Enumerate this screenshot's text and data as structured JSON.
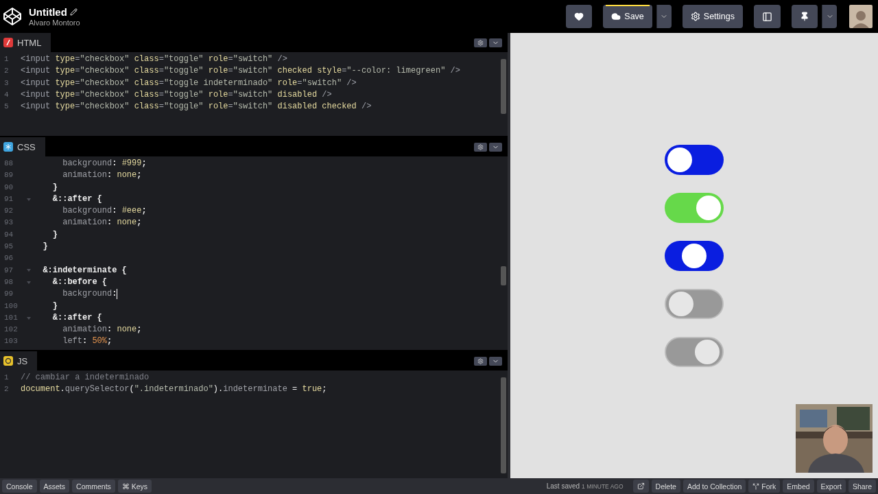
{
  "header": {
    "title": "Untitled",
    "author": "Alvaro Montoro",
    "buttons": [
      {
        "kind": "like"
      },
      {
        "kind": "save",
        "label": "Save",
        "split": true
      },
      {
        "kind": "settings",
        "label": "Settings"
      },
      {
        "kind": "layout"
      },
      {
        "kind": "pin",
        "split": true
      }
    ]
  },
  "editors": [
    {
      "kind": "html",
      "label": "HTML",
      "lines": [
        {
          "number": "1",
          "tokens": [
            {
              "kind": "tag",
              "text": "<input "
            },
            {
              "kind": "attr",
              "text": "type"
            },
            {
              "kind": "tag",
              "text": "="
            },
            {
              "kind": "str",
              "text": "\"checkbox\" "
            },
            {
              "kind": "attr",
              "text": "class"
            },
            {
              "kind": "tag",
              "text": "="
            },
            {
              "kind": "str",
              "text": "\"toggle\" "
            },
            {
              "kind": "attr",
              "text": "role"
            },
            {
              "kind": "tag",
              "text": "="
            },
            {
              "kind": "str",
              "text": "\"switch\" "
            },
            {
              "kind": "tag",
              "text": "/>"
            }
          ]
        },
        {
          "number": "2",
          "tokens": [
            {
              "kind": "tag",
              "text": "<input "
            },
            {
              "kind": "attr",
              "text": "type"
            },
            {
              "kind": "tag",
              "text": "="
            },
            {
              "kind": "str",
              "text": "\"checkbox\" "
            },
            {
              "kind": "attr",
              "text": "class"
            },
            {
              "kind": "tag",
              "text": "="
            },
            {
              "kind": "str",
              "text": "\"toggle\" "
            },
            {
              "kind": "attr",
              "text": "role"
            },
            {
              "kind": "tag",
              "text": "="
            },
            {
              "kind": "str",
              "text": "\"switch\" "
            },
            {
              "kind": "attr",
              "text": "checked style"
            },
            {
              "kind": "tag",
              "text": "="
            },
            {
              "kind": "str",
              "text": "\"--color: limegreen\" "
            },
            {
              "kind": "tag",
              "text": "/>"
            }
          ]
        },
        {
          "number": "3",
          "tokens": [
            {
              "kind": "tag",
              "text": "<input "
            },
            {
              "kind": "attr",
              "text": "type"
            },
            {
              "kind": "tag",
              "text": "="
            },
            {
              "kind": "str",
              "text": "\"checkbox\" "
            },
            {
              "kind": "attr",
              "text": "class"
            },
            {
              "kind": "tag",
              "text": "="
            },
            {
              "kind": "str",
              "text": "\"toggle indeterminado\" "
            },
            {
              "kind": "attr",
              "text": "role"
            },
            {
              "kind": "tag",
              "text": "="
            },
            {
              "kind": "str",
              "text": "\"switch\" "
            },
            {
              "kind": "tag",
              "text": "/>"
            }
          ]
        },
        {
          "number": "4",
          "tokens": [
            {
              "kind": "tag",
              "text": "<input "
            },
            {
              "kind": "attr",
              "text": "type"
            },
            {
              "kind": "tag",
              "text": "="
            },
            {
              "kind": "str",
              "text": "\"checkbox\" "
            },
            {
              "kind": "attr",
              "text": "class"
            },
            {
              "kind": "tag",
              "text": "="
            },
            {
              "kind": "str",
              "text": "\"toggle\" "
            },
            {
              "kind": "attr",
              "text": "role"
            },
            {
              "kind": "tag",
              "text": "="
            },
            {
              "kind": "str",
              "text": "\"switch\" "
            },
            {
              "kind": "attr",
              "text": "disabled "
            },
            {
              "kind": "tag",
              "text": "/>"
            }
          ]
        },
        {
          "number": "5",
          "tokens": [
            {
              "kind": "tag",
              "text": "<input "
            },
            {
              "kind": "attr",
              "text": "type"
            },
            {
              "kind": "tag",
              "text": "="
            },
            {
              "kind": "str",
              "text": "\"checkbox\" "
            },
            {
              "kind": "attr",
              "text": "class"
            },
            {
              "kind": "tag",
              "text": "="
            },
            {
              "kind": "str",
              "text": "\"toggle\" "
            },
            {
              "kind": "attr",
              "text": "role"
            },
            {
              "kind": "tag",
              "text": "="
            },
            {
              "kind": "str",
              "text": "\"switch\" "
            },
            {
              "kind": "attr",
              "text": "disabled checked "
            },
            {
              "kind": "tag",
              "text": "/>"
            }
          ]
        }
      ]
    },
    {
      "kind": "css",
      "label": "CSS",
      "lines": [
        {
          "number": "88",
          "tokens": [
            {
              "kind": "prop",
              "text": "      background"
            },
            {
              "kind": "sel",
              "text": ": "
            },
            {
              "kind": "value",
              "text": "#999"
            },
            {
              "kind": "sel",
              "text": ";"
            }
          ]
        },
        {
          "number": "89",
          "tokens": [
            {
              "kind": "prop",
              "text": "      animation"
            },
            {
              "kind": "sel",
              "text": ": "
            },
            {
              "kind": "value",
              "text": "none"
            },
            {
              "kind": "sel",
              "text": ";"
            }
          ]
        },
        {
          "number": "90",
          "tokens": [
            {
              "kind": "sel",
              "text": "    }"
            }
          ]
        },
        {
          "number": "91",
          "foldable": true,
          "tokens": [
            {
              "kind": "sel",
              "text": "    &::after {"
            }
          ]
        },
        {
          "number": "92",
          "tokens": [
            {
              "kind": "prop",
              "text": "      background"
            },
            {
              "kind": "sel",
              "text": ": "
            },
            {
              "kind": "value",
              "text": "#eee"
            },
            {
              "kind": "sel",
              "text": ";"
            }
          ]
        },
        {
          "number": "93",
          "tokens": [
            {
              "kind": "prop",
              "text": "      animation"
            },
            {
              "kind": "sel",
              "text": ": "
            },
            {
              "kind": "value",
              "text": "none"
            },
            {
              "kind": "sel",
              "text": ";"
            }
          ]
        },
        {
          "number": "94",
          "tokens": [
            {
              "kind": "sel",
              "text": "    }"
            }
          ]
        },
        {
          "number": "95",
          "tokens": [
            {
              "kind": "sel",
              "text": "  }"
            }
          ]
        },
        {
          "number": "96"
        },
        {
          "number": "97",
          "foldable": true,
          "tokens": [
            {
              "kind": "sel",
              "text": "  &:indeterminate {"
            }
          ]
        },
        {
          "number": "98",
          "foldable": true,
          "tokens": [
            {
              "kind": "sel",
              "text": "    &::before {"
            }
          ]
        },
        {
          "number": "99",
          "cursor": true,
          "tokens": [
            {
              "kind": "prop",
              "text": "      background"
            },
            {
              "kind": "sel",
              "text": ":"
            }
          ]
        },
        {
          "number": "100",
          "tokens": [
            {
              "kind": "sel",
              "text": "    }"
            }
          ]
        },
        {
          "number": "101",
          "foldable": true,
          "tokens": [
            {
              "kind": "sel",
              "text": "    &::after {"
            }
          ]
        },
        {
          "number": "102",
          "tokens": [
            {
              "kind": "prop",
              "text": "      animation"
            },
            {
              "kind": "sel",
              "text": ": "
            },
            {
              "kind": "value",
              "text": "none"
            },
            {
              "kind": "sel",
              "text": ";"
            }
          ]
        },
        {
          "number": "103",
          "tokens": [
            {
              "kind": "prop",
              "text": "      left"
            },
            {
              "kind": "sel",
              "text": ": "
            },
            {
              "kind": "number",
              "text": "50%"
            },
            {
              "kind": "sel",
              "text": ";"
            }
          ]
        }
      ]
    },
    {
      "kind": "js",
      "label": "JS",
      "lines": [
        {
          "number": "1",
          "tokens": [
            {
              "kind": "comment",
              "text": "// cambiar a indeterminado"
            }
          ]
        },
        {
          "number": "2",
          "tokens": [
            {
              "kind": "attr",
              "text": "document"
            },
            {
              "kind": "sel",
              "text": "."
            },
            {
              "kind": "prop",
              "text": "querySelector"
            },
            {
              "kind": "sel",
              "text": "("
            },
            {
              "kind": "str",
              "text": "\".indeterminado\""
            },
            {
              "kind": "sel",
              "text": ")."
            },
            {
              "kind": "prop",
              "text": "indeterminate"
            },
            {
              "kind": "sel",
              "text": " = "
            },
            {
              "kind": "value",
              "text": "true"
            },
            {
              "kind": "sel",
              "text": ";"
            }
          ]
        }
      ]
    }
  ],
  "preview": {
    "toggles": [
      {
        "kind": "off",
        "disabled": false,
        "color": "#0a1ee0"
      },
      {
        "kind": "on",
        "disabled": false,
        "color": "#66d94a"
      },
      {
        "kind": "indeterminate",
        "disabled": false,
        "color": "#0a1ee0"
      },
      {
        "kind": "off",
        "disabled": true,
        "color": "#999999"
      },
      {
        "kind": "on",
        "disabled": true,
        "color": "#999999"
      }
    ]
  },
  "footer": {
    "left": [
      {
        "label": "Console"
      },
      {
        "label": "Assets"
      },
      {
        "label": "Comments"
      },
      {
        "label": "⌘ Keys"
      }
    ],
    "saved": {
      "label": "Last saved",
      "time": "1 MINUTE AGO"
    },
    "right": [
      {
        "kind": "open"
      },
      {
        "kind": "text",
        "label": "Delete"
      },
      {
        "kind": "text",
        "label": "Add to Collection"
      },
      {
        "kind": "fork",
        "label": "Fork"
      },
      {
        "kind": "text",
        "label": "Embed"
      },
      {
        "kind": "text",
        "label": "Export"
      },
      {
        "kind": "text",
        "label": "Share"
      }
    ]
  }
}
